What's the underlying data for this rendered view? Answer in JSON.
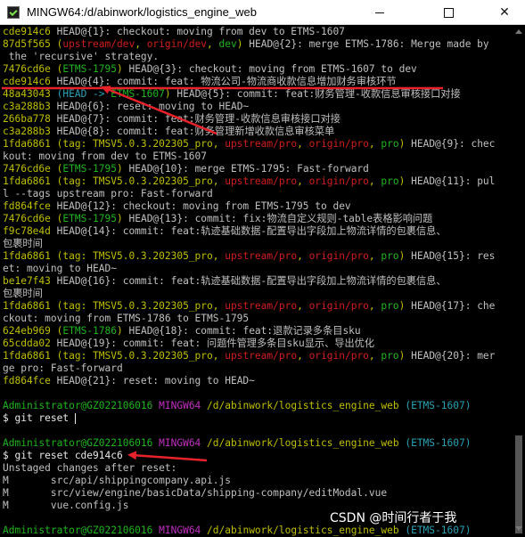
{
  "window": {
    "title": "MINGW64:/d/abinwork/logistics_engine_web",
    "buttons": {
      "minimize": "—",
      "maximize": "☐",
      "close": "✕"
    }
  },
  "terminal": {
    "lines": [
      [
        {
          "t": "cde914c6",
          "c": "y"
        },
        {
          "t": " HEAD@{1}: checkout: moving from dev to ETMS-1607",
          "c": "w"
        }
      ],
      [
        {
          "t": "87d5f565 ",
          "c": "y"
        },
        {
          "t": "(",
          "c": "y"
        },
        {
          "t": "upstream/dev",
          "c": "r"
        },
        {
          "t": ", ",
          "c": "y"
        },
        {
          "t": "origin/dev",
          "c": "r"
        },
        {
          "t": ", ",
          "c": "y"
        },
        {
          "t": "dev",
          "c": "g"
        },
        {
          "t": ")",
          "c": "y"
        },
        {
          "t": " HEAD@{2}: merge ETMS-1786: Merge made by",
          "c": "w"
        }
      ],
      [
        {
          "t": " the 'recursive' strategy.",
          "c": "w"
        }
      ],
      [
        {
          "t": "7476cd6e ",
          "c": "y"
        },
        {
          "t": "(",
          "c": "y"
        },
        {
          "t": "ETMS-1795",
          "c": "g"
        },
        {
          "t": ")",
          "c": "y"
        },
        {
          "t": " HEAD@{3}: checkout: moving from ETMS-1607 to dev",
          "c": "w"
        }
      ],
      [
        {
          "t": "cde914c6",
          "c": "y"
        },
        {
          "t": " HEAD@{4}: commit: feat: 物流公司-物流商收款信息增加财务审核环节",
          "c": "w"
        }
      ],
      [
        {
          "t": "48a43043 ",
          "c": "y"
        },
        {
          "t": "(HEAD -> ",
          "c": "c"
        },
        {
          "t": "ETMS-1607",
          "c": "g"
        },
        {
          "t": ")",
          "c": "y"
        },
        {
          "t": " HEAD@{5}: commit: feat:财务管理-收款信息审核接口对接",
          "c": "w"
        }
      ],
      [
        {
          "t": "c3a288b3",
          "c": "y"
        },
        {
          "t": " HEAD@{6}: reset: moving to HEAD~",
          "c": "w"
        }
      ],
      [
        {
          "t": "266ba778",
          "c": "y"
        },
        {
          "t": " HEAD@{7}: commit: feat:财务管理-收款信息审核接口对接",
          "c": "w"
        }
      ],
      [
        {
          "t": "c3a288b3",
          "c": "y"
        },
        {
          "t": " HEAD@{8}: commit: feat:财务管理新增收款信息审核菜单",
          "c": "w"
        }
      ],
      [
        {
          "t": "1fda6861 ",
          "c": "y"
        },
        {
          "t": "(",
          "c": "y"
        },
        {
          "t": "tag: TMSV5.0.3.202305_pro",
          "c": "y"
        },
        {
          "t": ", ",
          "c": "y"
        },
        {
          "t": "upstream/pro",
          "c": "r"
        },
        {
          "t": ", ",
          "c": "y"
        },
        {
          "t": "origin/pro",
          "c": "r"
        },
        {
          "t": ", ",
          "c": "y"
        },
        {
          "t": "pro",
          "c": "g"
        },
        {
          "t": ")",
          "c": "y"
        },
        {
          "t": " HEAD@{9}: chec",
          "c": "w"
        }
      ],
      [
        {
          "t": "kout: moving from dev to ETMS-1607",
          "c": "w"
        }
      ],
      [
        {
          "t": "7476cd6e ",
          "c": "y"
        },
        {
          "t": "(",
          "c": "y"
        },
        {
          "t": "ETMS-1795",
          "c": "g"
        },
        {
          "t": ")",
          "c": "y"
        },
        {
          "t": " HEAD@{10}: merge ETMS-1795: Fast-forward",
          "c": "w"
        }
      ],
      [
        {
          "t": "1fda6861 ",
          "c": "y"
        },
        {
          "t": "(",
          "c": "y"
        },
        {
          "t": "tag: TMSV5.0.3.202305_pro",
          "c": "y"
        },
        {
          "t": ", ",
          "c": "y"
        },
        {
          "t": "upstream/pro",
          "c": "r"
        },
        {
          "t": ", ",
          "c": "y"
        },
        {
          "t": "origin/pro",
          "c": "r"
        },
        {
          "t": ", ",
          "c": "y"
        },
        {
          "t": "pro",
          "c": "g"
        },
        {
          "t": ")",
          "c": "y"
        },
        {
          "t": " HEAD@{11}: pul",
          "c": "w"
        }
      ],
      [
        {
          "t": "l --tags upstream pro: Fast-forward",
          "c": "w"
        }
      ],
      [
        {
          "t": "fd864fce",
          "c": "y"
        },
        {
          "t": " HEAD@{12}: checkout: moving from ETMS-1795 to dev",
          "c": "w"
        }
      ],
      [
        {
          "t": "7476cd6e ",
          "c": "y"
        },
        {
          "t": "(",
          "c": "y"
        },
        {
          "t": "ETMS-1795",
          "c": "g"
        },
        {
          "t": ")",
          "c": "y"
        },
        {
          "t": " HEAD@{13}: commit: fix:物流自定义规则-table表格影响问题",
          "c": "w"
        }
      ],
      [
        {
          "t": "f9c78e4d",
          "c": "y"
        },
        {
          "t": " HEAD@{14}: commit: feat:轨迹基础数据-配置导出字段加上物流详情的包裹信息、",
          "c": "w"
        }
      ],
      [
        {
          "t": "包裹时间",
          "c": "w"
        }
      ],
      [
        {
          "t": "1fda6861 ",
          "c": "y"
        },
        {
          "t": "(",
          "c": "y"
        },
        {
          "t": "tag: TMSV5.0.3.202305_pro",
          "c": "y"
        },
        {
          "t": ", ",
          "c": "y"
        },
        {
          "t": "upstream/pro",
          "c": "r"
        },
        {
          "t": ", ",
          "c": "y"
        },
        {
          "t": "origin/pro",
          "c": "r"
        },
        {
          "t": ", ",
          "c": "y"
        },
        {
          "t": "pro",
          "c": "g"
        },
        {
          "t": ")",
          "c": "y"
        },
        {
          "t": " HEAD@{15}: res",
          "c": "w"
        }
      ],
      [
        {
          "t": "et: moving to HEAD~",
          "c": "w"
        }
      ],
      [
        {
          "t": "be1e7f43",
          "c": "y"
        },
        {
          "t": " HEAD@{16}: commit: feat:轨迹基础数据-配置导出字段加上物流详情的包裹信息、",
          "c": "w"
        }
      ],
      [
        {
          "t": "包裹时间",
          "c": "w"
        }
      ],
      [
        {
          "t": "1fda6861 ",
          "c": "y"
        },
        {
          "t": "(",
          "c": "y"
        },
        {
          "t": "tag: TMSV5.0.3.202305_pro",
          "c": "y"
        },
        {
          "t": ", ",
          "c": "y"
        },
        {
          "t": "upstream/pro",
          "c": "r"
        },
        {
          "t": ", ",
          "c": "y"
        },
        {
          "t": "origin/pro",
          "c": "r"
        },
        {
          "t": ", ",
          "c": "y"
        },
        {
          "t": "pro",
          "c": "g"
        },
        {
          "t": ")",
          "c": "y"
        },
        {
          "t": " HEAD@{17}: che",
          "c": "w"
        }
      ],
      [
        {
          "t": "ckout: moving from ETMS-1786 to ETMS-1795",
          "c": "w"
        }
      ],
      [
        {
          "t": "624eb969 ",
          "c": "y"
        },
        {
          "t": "(",
          "c": "y"
        },
        {
          "t": "ETMS-1786",
          "c": "g"
        },
        {
          "t": ")",
          "c": "y"
        },
        {
          "t": " HEAD@{18}: commit: feat:退款记录多条目sku",
          "c": "w"
        }
      ],
      [
        {
          "t": "65cdda02",
          "c": "y"
        },
        {
          "t": " HEAD@{19}: commit: feat: 问题件管理多条目sku显示、导出优化",
          "c": "w"
        }
      ],
      [
        {
          "t": "1fda6861 ",
          "c": "y"
        },
        {
          "t": "(",
          "c": "y"
        },
        {
          "t": "tag: TMSV5.0.3.202305_pro",
          "c": "y"
        },
        {
          "t": ", ",
          "c": "y"
        },
        {
          "t": "upstream/pro",
          "c": "r"
        },
        {
          "t": ", ",
          "c": "y"
        },
        {
          "t": "origin/pro",
          "c": "r"
        },
        {
          "t": ", ",
          "c": "y"
        },
        {
          "t": "pro",
          "c": "g"
        },
        {
          "t": ")",
          "c": "y"
        },
        {
          "t": " HEAD@{20}: mer",
          "c": "w"
        }
      ],
      [
        {
          "t": "ge pro: Fast-forward",
          "c": "w"
        }
      ],
      [
        {
          "t": "fd864fce",
          "c": "y"
        },
        {
          "t": " HEAD@{21}: reset: moving to HEAD~",
          "c": "w"
        }
      ],
      [
        {
          "t": "",
          "c": "w"
        }
      ],
      [
        {
          "t": "Administrator@GZ022106016",
          "c": "g"
        },
        {
          "t": " ",
          "c": "w"
        },
        {
          "t": "MINGW64",
          "c": "m"
        },
        {
          "t": " ",
          "c": "w"
        },
        {
          "t": "/d/abinwork/logistics_engine_web",
          "c": "y"
        },
        {
          "t": " ",
          "c": "w"
        },
        {
          "t": "(ETMS-1607)",
          "c": "c"
        }
      ],
      [
        {
          "t": "$ git reset ",
          "c": "wb"
        },
        {
          "t": "",
          "c": "cursor"
        }
      ],
      [
        {
          "t": "",
          "c": "w"
        }
      ],
      [
        {
          "t": "Administrator@GZ022106016",
          "c": "g"
        },
        {
          "t": " ",
          "c": "w"
        },
        {
          "t": "MINGW64",
          "c": "m"
        },
        {
          "t": " ",
          "c": "w"
        },
        {
          "t": "/d/abinwork/logistics_engine_web",
          "c": "y"
        },
        {
          "t": " ",
          "c": "w"
        },
        {
          "t": "(ETMS-1607)",
          "c": "c"
        }
      ],
      [
        {
          "t": "$ git reset cde914c6",
          "c": "wb"
        }
      ],
      [
        {
          "t": "Unstaged changes after reset:",
          "c": "w"
        }
      ],
      [
        {
          "t": "M       src/api/shippingcompany.api.js",
          "c": "w"
        }
      ],
      [
        {
          "t": "M       src/view/engine/basicData/shipping-company/editModal.vue",
          "c": "w"
        }
      ],
      [
        {
          "t": "M       vue.config.js",
          "c": "w"
        }
      ],
      [
        {
          "t": "",
          "c": "w"
        }
      ],
      [
        {
          "t": "Administrator@GZ022106016",
          "c": "g"
        },
        {
          "t": " ",
          "c": "w"
        },
        {
          "t": "MINGW64",
          "c": "m"
        },
        {
          "t": " ",
          "c": "w"
        },
        {
          "t": "/d/abinwork/logistics_engine_web",
          "c": "y"
        },
        {
          "t": " ",
          "c": "w"
        },
        {
          "t": "(ETMS-1607)",
          "c": "c"
        }
      ]
    ]
  },
  "watermark": "CSDN @时间行者于我",
  "colors": {
    "annotation_red": "#e8222a",
    "background": "#000000"
  }
}
